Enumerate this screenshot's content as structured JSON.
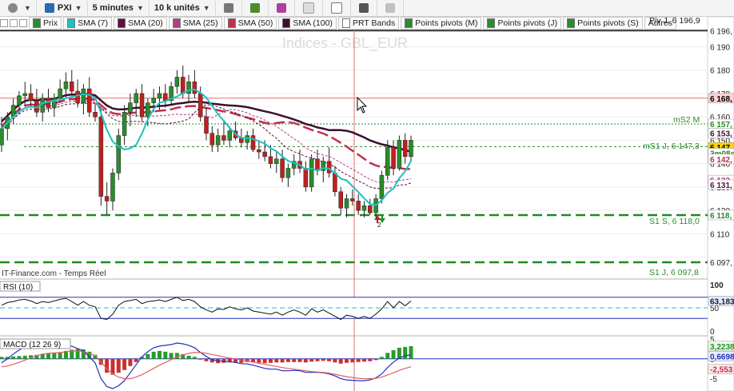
{
  "toolbar": {
    "symbol": "PXI",
    "timeframe": "5 minutes",
    "units": "10 k unités"
  },
  "indicators_bar": [
    {
      "label": "Prix",
      "color": "#2a8c2a"
    },
    {
      "label": "SMA (7)",
      "color": "#20c0c0"
    },
    {
      "label": "SMA (20)",
      "color": "#5a1040"
    },
    {
      "label": "SMA (25)",
      "color": "#b04080"
    },
    {
      "label": "SMA (50)",
      "color": "#c03050"
    },
    {
      "label": "SMA (100)",
      "color": "#3a1030"
    },
    {
      "label": "PRT Bands",
      "color": "#ffffff"
    },
    {
      "label": "Points pivots (M)",
      "color": "#2a8c2a"
    },
    {
      "label": "Points pivots (J)",
      "color": "#2a8c2a"
    },
    {
      "label": "Points pivots (S)",
      "color": "#2a8c2a"
    },
    {
      "label": "Autres",
      "color": null
    }
  ],
  "watermark": "Indices - GBL_EUR",
  "source": "IT-Finance.com - Temps Réel",
  "pivot_labels": {
    "piv_j": "Piv J, 6 196,9",
    "ms2_m": "mS2 M",
    "ms1_j": "mS1 J, 6 147,3",
    "s1_s": "S1 S, 6 118,0",
    "s1_j": "S1 J, 6 097,8"
  },
  "price_axis": {
    "ticks": [
      "6 196,",
      "6 190",
      "6 180",
      "6 170",
      "6 160",
      "6 150",
      "6 140",
      "6 130",
      "6 120",
      "6 110",
      "6 097,"
    ],
    "tags": [
      {
        "text": "6 168,",
        "bg": "#ffd0d0",
        "fg": "#000000"
      },
      {
        "text": "6 157,",
        "bg": "#ffffff",
        "fg": "#2a8c2a"
      },
      {
        "text": "6 153,",
        "bg": "#ffffff",
        "fg": "#3a1030"
      },
      {
        "text": "6 147,",
        "bg": "#ffd400",
        "fg": "#000000"
      },
      {
        "text": "3m08s",
        "bg": "#ffffff",
        "fg": "#2a8c2a"
      },
      {
        "text": "6 142,",
        "bg": "#ffffff",
        "fg": "#c03050"
      },
      {
        "text": "6 133,",
        "bg": "#ffffff",
        "fg": "#b04080"
      },
      {
        "text": "6 131,",
        "bg": "#ffffff",
        "fg": "#5a1040"
      },
      {
        "text": "6 118,",
        "bg": "#ffffff",
        "fg": "#2a8c2a"
      }
    ]
  },
  "rsi": {
    "label": "RSI (10)",
    "ticks": [
      "100",
      "50",
      "0"
    ],
    "tag": "63,183",
    "tag_bg": "#e0eaff"
  },
  "macd": {
    "label": "MACD (12 26 9)",
    "ticks": [
      "5",
      "0",
      "-5"
    ],
    "tags": [
      {
        "text": "3,2238",
        "bg": "#e8ffe8",
        "fg": "#2a8c2a"
      },
      {
        "text": "0,6698",
        "bg": "#e8eeff",
        "fg": "#2030c0"
      },
      {
        "text": "-2,553",
        "bg": "#ffe8e8",
        "fg": "#c03050"
      }
    ]
  },
  "chart_data": {
    "type": "candlestick",
    "ylim": [
      6092,
      6197
    ],
    "candles": [
      {
        "o": 6148,
        "h": 6160,
        "l": 6145,
        "c": 6155
      },
      {
        "o": 6155,
        "h": 6162,
        "l": 6150,
        "c": 6160
      },
      {
        "o": 6160,
        "h": 6168,
        "l": 6157,
        "c": 6165
      },
      {
        "o": 6165,
        "h": 6171,
        "l": 6161,
        "c": 6169
      },
      {
        "o": 6169,
        "h": 6175,
        "l": 6165,
        "c": 6170
      },
      {
        "o": 6170,
        "h": 6174,
        "l": 6164,
        "c": 6167
      },
      {
        "o": 6167,
        "h": 6172,
        "l": 6160,
        "c": 6162
      },
      {
        "o": 6162,
        "h": 6170,
        "l": 6158,
        "c": 6168
      },
      {
        "o": 6168,
        "h": 6172,
        "l": 6162,
        "c": 6164
      },
      {
        "o": 6164,
        "h": 6170,
        "l": 6160,
        "c": 6168
      },
      {
        "o": 6168,
        "h": 6176,
        "l": 6166,
        "c": 6172
      },
      {
        "o": 6172,
        "h": 6179,
        "l": 6168,
        "c": 6175
      },
      {
        "o": 6175,
        "h": 6180,
        "l": 6169,
        "c": 6171
      },
      {
        "o": 6171,
        "h": 6176,
        "l": 6164,
        "c": 6166
      },
      {
        "o": 6166,
        "h": 6174,
        "l": 6161,
        "c": 6172
      },
      {
        "o": 6172,
        "h": 6177,
        "l": 6160,
        "c": 6162
      },
      {
        "o": 6162,
        "h": 6166,
        "l": 6158,
        "c": 6160
      },
      {
        "o": 6160,
        "h": 6164,
        "l": 6122,
        "c": 6126
      },
      {
        "o": 6126,
        "h": 6132,
        "l": 6118,
        "c": 6124
      },
      {
        "o": 6124,
        "h": 6138,
        "l": 6120,
        "c": 6136
      },
      {
        "o": 6136,
        "h": 6155,
        "l": 6133,
        "c": 6152
      },
      {
        "o": 6152,
        "h": 6165,
        "l": 6148,
        "c": 6162
      },
      {
        "o": 6162,
        "h": 6170,
        "l": 6156,
        "c": 6166
      },
      {
        "o": 6166,
        "h": 6172,
        "l": 6160,
        "c": 6170
      },
      {
        "o": 6170,
        "h": 6174,
        "l": 6158,
        "c": 6160
      },
      {
        "o": 6160,
        "h": 6168,
        "l": 6156,
        "c": 6166
      },
      {
        "o": 6166,
        "h": 6172,
        "l": 6162,
        "c": 6168
      },
      {
        "o": 6168,
        "h": 6173,
        "l": 6163,
        "c": 6170
      },
      {
        "o": 6170,
        "h": 6174,
        "l": 6164,
        "c": 6167
      },
      {
        "o": 6167,
        "h": 6175,
        "l": 6165,
        "c": 6173
      },
      {
        "o": 6173,
        "h": 6180,
        "l": 6170,
        "c": 6177
      },
      {
        "o": 6177,
        "h": 6182,
        "l": 6168,
        "c": 6170
      },
      {
        "o": 6170,
        "h": 6178,
        "l": 6166,
        "c": 6175
      },
      {
        "o": 6175,
        "h": 6180,
        "l": 6168,
        "c": 6170
      },
      {
        "o": 6170,
        "h": 6173,
        "l": 6158,
        "c": 6160
      },
      {
        "o": 6160,
        "h": 6164,
        "l": 6150,
        "c": 6153
      },
      {
        "o": 6153,
        "h": 6156,
        "l": 6145,
        "c": 6148
      },
      {
        "o": 6148,
        "h": 6155,
        "l": 6145,
        "c": 6152
      },
      {
        "o": 6152,
        "h": 6158,
        "l": 6148,
        "c": 6150
      },
      {
        "o": 6150,
        "h": 6156,
        "l": 6147,
        "c": 6154
      },
      {
        "o": 6154,
        "h": 6158,
        "l": 6150,
        "c": 6151
      },
      {
        "o": 6151,
        "h": 6155,
        "l": 6147,
        "c": 6149
      },
      {
        "o": 6149,
        "h": 6154,
        "l": 6146,
        "c": 6152
      },
      {
        "o": 6152,
        "h": 6155,
        "l": 6145,
        "c": 6146
      },
      {
        "o": 6146,
        "h": 6150,
        "l": 6142,
        "c": 6145
      },
      {
        "o": 6145,
        "h": 6150,
        "l": 6141,
        "c": 6143
      },
      {
        "o": 6143,
        "h": 6148,
        "l": 6138,
        "c": 6140
      },
      {
        "o": 6140,
        "h": 6145,
        "l": 6136,
        "c": 6142
      },
      {
        "o": 6142,
        "h": 6146,
        "l": 6132,
        "c": 6134
      },
      {
        "o": 6134,
        "h": 6140,
        "l": 6130,
        "c": 6138
      },
      {
        "o": 6138,
        "h": 6144,
        "l": 6135,
        "c": 6141
      },
      {
        "o": 6141,
        "h": 6146,
        "l": 6136,
        "c": 6138
      },
      {
        "o": 6138,
        "h": 6141,
        "l": 6128,
        "c": 6130
      },
      {
        "o": 6130,
        "h": 6144,
        "l": 6128,
        "c": 6142
      },
      {
        "o": 6142,
        "h": 6146,
        "l": 6135,
        "c": 6137
      },
      {
        "o": 6137,
        "h": 6143,
        "l": 6132,
        "c": 6141
      },
      {
        "o": 6141,
        "h": 6147,
        "l": 6134,
        "c": 6136
      },
      {
        "o": 6136,
        "h": 6139,
        "l": 6126,
        "c": 6128
      },
      {
        "o": 6128,
        "h": 6130,
        "l": 6118,
        "c": 6121
      },
      {
        "o": 6121,
        "h": 6127,
        "l": 6117,
        "c": 6125
      },
      {
        "o": 6125,
        "h": 6129,
        "l": 6122,
        "c": 6124
      },
      {
        "o": 6124,
        "h": 6127,
        "l": 6118,
        "c": 6120
      },
      {
        "o": 6120,
        "h": 6124,
        "l": 6117,
        "c": 6122
      },
      {
        "o": 6122,
        "h": 6125,
        "l": 6118,
        "c": 6119
      },
      {
        "o": 6119,
        "h": 6127,
        "l": 6117,
        "c": 6125
      },
      {
        "o": 6125,
        "h": 6137,
        "l": 6123,
        "c": 6135
      },
      {
        "o": 6135,
        "h": 6150,
        "l": 6133,
        "c": 6147
      },
      {
        "o": 6147,
        "h": 6150,
        "l": 6135,
        "c": 6138
      },
      {
        "o": 6138,
        "h": 6152,
        "l": 6137,
        "c": 6150
      },
      {
        "o": 6150,
        "h": 6153,
        "l": 6140,
        "c": 6143
      },
      {
        "o": 6143,
        "h": 6152,
        "l": 6141,
        "c": 6150
      }
    ],
    "rsi": [
      55,
      60,
      62,
      65,
      66,
      63,
      58,
      62,
      60,
      63,
      66,
      68,
      62,
      55,
      62,
      55,
      52,
      30,
      28,
      38,
      55,
      62,
      64,
      66,
      58,
      62,
      63,
      65,
      62,
      66,
      70,
      64,
      66,
      62,
      52,
      46,
      42,
      48,
      47,
      52,
      48,
      46,
      50,
      44,
      42,
      40,
      38,
      42,
      36,
      42,
      46,
      42,
      36,
      48,
      42,
      46,
      40,
      34,
      28,
      36,
      34,
      30,
      34,
      30,
      38,
      48,
      62,
      50,
      62,
      54,
      63
    ],
    "macd_hist": [
      0.5,
      0.5,
      0.6,
      0.7,
      0.8,
      0.9,
      1.0,
      1.2,
      1.3,
      1.5,
      1.7,
      2.0,
      2.3,
      2.5,
      2.4,
      1.8,
      1.0,
      -1.5,
      -3.5,
      -4.0,
      -3.5,
      -2.8,
      -1.8,
      -0.8,
      0.5,
      1.2,
      1.8,
      2.0,
      1.8,
      1.5,
      1.5,
      1.2,
      0.8,
      0.5,
      -0.2,
      -0.6,
      -0.9,
      -1.1,
      -1.0,
      -0.9,
      -1.0,
      -1.0,
      -0.8,
      -0.9,
      -1.0,
      -1.1,
      -1.0,
      -0.9,
      -0.9,
      -0.8,
      -0.8,
      -0.8,
      -0.9,
      -0.7,
      -0.6,
      -0.5,
      -0.6,
      -0.9,
      -1.2,
      -1.0,
      -0.9,
      -0.8,
      -0.7,
      -0.6,
      -0.3,
      0.5,
      1.5,
      2.2,
      2.8,
      3.0,
      3.2
    ],
    "macd_line": [
      -1.0,
      0.0,
      1.2,
      2.2,
      3.0,
      3.2,
      3.0,
      2.8,
      2.8,
      3.0,
      3.2,
      3.5,
      3.2,
      2.6,
      2.0,
      0.5,
      -1.0,
      -5.0,
      -7.0,
      -7.5,
      -6.8,
      -5.5,
      -3.5,
      -1.5,
      0.5,
      1.8,
      2.8,
      3.2,
      3.4,
      3.6,
      4.0,
      3.8,
      3.4,
      2.8,
      1.6,
      0.6,
      -0.2,
      -0.5,
      -0.6,
      -0.7,
      -0.9,
      -1.2,
      -1.3,
      -1.6,
      -2.0,
      -2.4,
      -2.6,
      -2.6,
      -3.0,
      -3.0,
      -2.9,
      -3.0,
      -3.4,
      -3.4,
      -3.4,
      -3.5,
      -3.8,
      -4.3,
      -5.0,
      -5.3,
      -5.4,
      -5.5,
      -5.5,
      -5.3,
      -4.8,
      -3.8,
      -2.2,
      -0.8,
      0.2,
      0.8,
      1.0
    ],
    "signal_line": [
      -2.0,
      -1.8,
      -1.4,
      -0.9,
      -0.3,
      0.3,
      0.8,
      1.2,
      1.4,
      1.5,
      1.6,
      1.8,
      2.0,
      2.0,
      1.8,
      1.4,
      0.8,
      -0.8,
      -2.5,
      -3.8,
      -4.6,
      -5.0,
      -5.0,
      -4.6,
      -4.0,
      -3.2,
      -2.4,
      -1.6,
      -0.9,
      -0.2,
      0.5,
      1.0,
      1.4,
      1.6,
      1.6,
      1.4,
      1.1,
      0.8,
      0.5,
      0.2,
      0.0,
      -0.3,
      -0.5,
      -0.8,
      -1.1,
      -1.4,
      -1.7,
      -1.9,
      -2.2,
      -2.4,
      -2.6,
      -2.8,
      -3.0,
      -3.2,
      -3.3,
      -3.4,
      -3.6,
      -3.9,
      -4.2,
      -4.5,
      -4.7,
      -4.9,
      -5.0,
      -5.0,
      -4.9,
      -4.6,
      -4.1,
      -3.5,
      -2.9,
      -2.4,
      -2.0
    ]
  }
}
